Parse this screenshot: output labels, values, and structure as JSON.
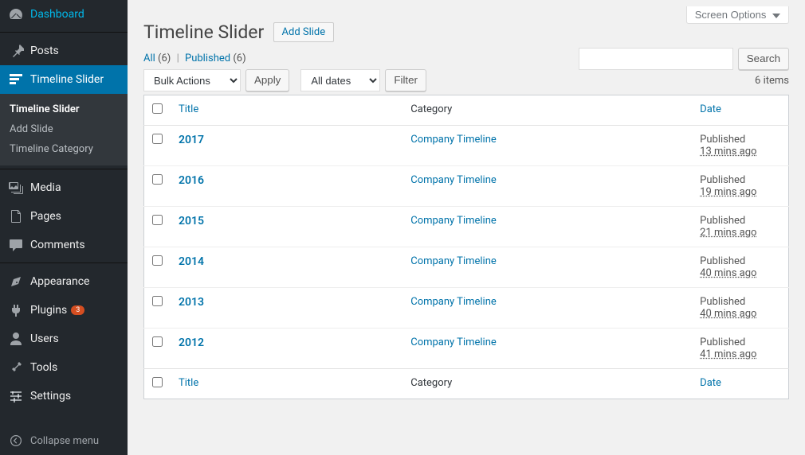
{
  "sidebar": {
    "items": [
      {
        "id": "dashboard",
        "label": "Dashboard",
        "icon": "dashboard"
      },
      {
        "id": "posts",
        "label": "Posts",
        "icon": "pin"
      },
      {
        "id": "timeline-slider",
        "label": "Timeline Slider",
        "icon": "timeline",
        "current": true,
        "submenu": [
          {
            "label": "Timeline Slider",
            "current": true
          },
          {
            "label": "Add Slide"
          },
          {
            "label": "Timeline Category"
          }
        ]
      },
      {
        "id": "media",
        "label": "Media",
        "icon": "media"
      },
      {
        "id": "pages",
        "label": "Pages",
        "icon": "page"
      },
      {
        "id": "comments",
        "label": "Comments",
        "icon": "comment"
      },
      {
        "id": "appearance",
        "label": "Appearance",
        "icon": "appearance"
      },
      {
        "id": "plugins",
        "label": "Plugins",
        "icon": "plugin",
        "badge": "3"
      },
      {
        "id": "users",
        "label": "Users",
        "icon": "user"
      },
      {
        "id": "tools",
        "label": "Tools",
        "icon": "tool"
      },
      {
        "id": "settings",
        "label": "Settings",
        "icon": "settings"
      }
    ],
    "collapse_label": "Collapse menu"
  },
  "header": {
    "screen_options": "Screen Options",
    "page_title": "Timeline Slider",
    "add_new": "Add Slide"
  },
  "filters": {
    "all_label": "All",
    "all_count": "(6)",
    "published_label": "Published",
    "published_count": "(6)",
    "bulk_actions": "Bulk Actions",
    "apply": "Apply",
    "all_dates": "All dates",
    "filter": "Filter",
    "search": "Search",
    "items_count": "6 items"
  },
  "table": {
    "columns": {
      "title": "Title",
      "category": "Category",
      "date": "Date"
    },
    "rows": [
      {
        "title": "2017",
        "category": "Company Timeline",
        "status": "Published",
        "time": "13 mins ago"
      },
      {
        "title": "2016",
        "category": "Company Timeline",
        "status": "Published",
        "time": "19 mins ago"
      },
      {
        "title": "2015",
        "category": "Company Timeline",
        "status": "Published",
        "time": "21 mins ago"
      },
      {
        "title": "2014",
        "category": "Company Timeline",
        "status": "Published",
        "time": "40 mins ago"
      },
      {
        "title": "2013",
        "category": "Company Timeline",
        "status": "Published",
        "time": "40 mins ago"
      },
      {
        "title": "2012",
        "category": "Company Timeline",
        "status": "Published",
        "time": "41 mins ago"
      }
    ]
  }
}
